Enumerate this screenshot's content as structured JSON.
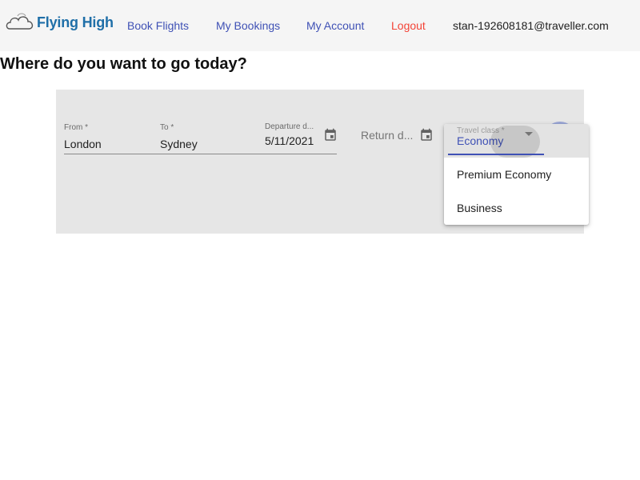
{
  "app": {
    "brand": "Flying High"
  },
  "nav": {
    "book_flights": "Book Flights",
    "my_bookings": "My Bookings",
    "my_account": "My Account",
    "logout": "Logout",
    "user_email": "stan-192608181@traveller.com"
  },
  "page": {
    "title": "Where do you want to go today?"
  },
  "form": {
    "from": {
      "label": "From *",
      "value": "London"
    },
    "to": {
      "label": "To *",
      "value": "Sydney"
    },
    "departure": {
      "label": "Departure d...",
      "value": "5/11/2021"
    },
    "return": {
      "placeholder": "Return d..."
    },
    "travel_class": {
      "label": "Travel class *",
      "selected": "Economy",
      "options": [
        "Economy",
        "Premium Economy",
        "Business"
      ]
    }
  },
  "icons": {
    "calendar": "calendar-icon",
    "search": "search-icon",
    "dropdown": "chevron-down-icon"
  },
  "colors": {
    "primary": "#3f51b5",
    "warn": "#f44336",
    "panel": "#e6e6e6",
    "header": "#f5f5f5"
  }
}
